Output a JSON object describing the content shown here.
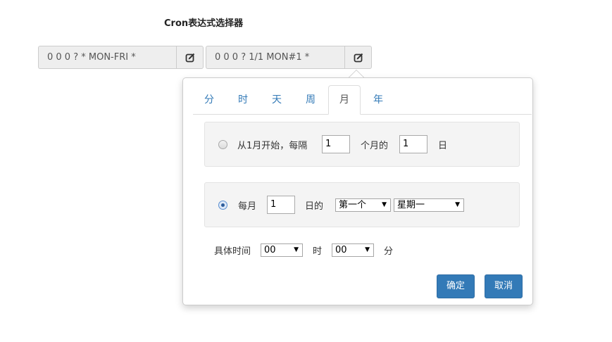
{
  "page": {
    "title": "Cron表达式选择器"
  },
  "expr_fields": [
    {
      "value": "0 0 0 ? * MON-FRI *",
      "icon": "edit-icon"
    },
    {
      "value": "0 0 0 ? 1/1 MON#1 *",
      "icon": "edit-icon"
    }
  ],
  "tabs": [
    {
      "label": "分",
      "active": false
    },
    {
      "label": "时",
      "active": false
    },
    {
      "label": "天",
      "active": false
    },
    {
      "label": "周",
      "active": false
    },
    {
      "label": "月",
      "active": true
    },
    {
      "label": "年",
      "active": false
    }
  ],
  "option1": {
    "selected": false,
    "text_start": "从1月开始，每隔",
    "interval_value": "1",
    "text_mid": "个月的",
    "day_value": "1",
    "text_end": "日"
  },
  "option2": {
    "selected": true,
    "text_start": "每月",
    "month_value": "1",
    "text_mid": "日的",
    "week_ordinal": "第一个",
    "weekday": "星期一"
  },
  "time": {
    "label": "具体时间",
    "hour": "00",
    "hour_unit": "时",
    "minute": "00",
    "minute_unit": "分"
  },
  "buttons": {
    "confirm": "确定",
    "cancel": "取消"
  },
  "colors": {
    "accent": "#337ab7",
    "link": "#337ab7",
    "field_bg": "#eeeeee"
  }
}
